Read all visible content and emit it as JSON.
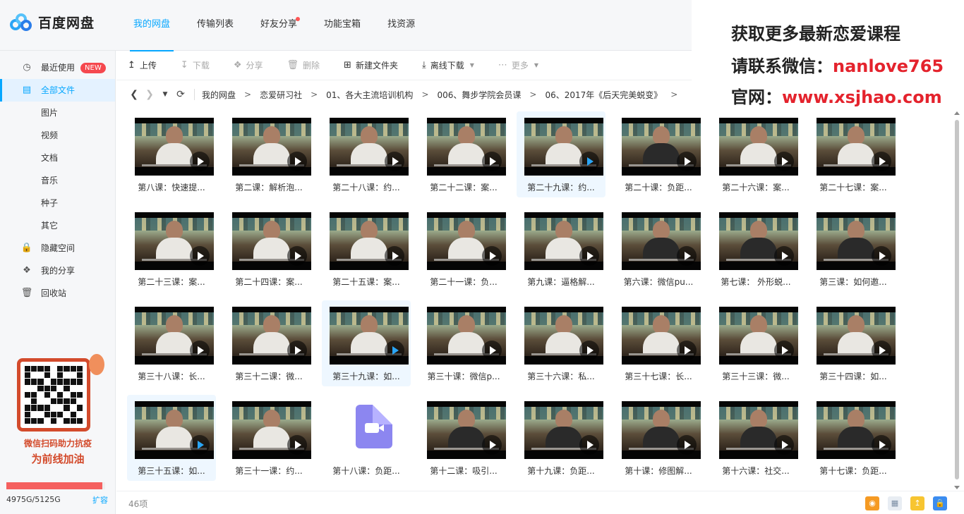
{
  "app": {
    "logo_text": "百度网盘"
  },
  "topnav": [
    {
      "label": "我的网盘",
      "active": true
    },
    {
      "label": "传输列表",
      "active": false
    },
    {
      "label": "好友分享",
      "active": false
    },
    {
      "label": "功能宝箱",
      "active": false
    },
    {
      "label": "找资源",
      "active": false
    }
  ],
  "ad": {
    "line1": "获取更多最新恋爱课程",
    "line2_label": "请联系微信：",
    "line2_value": "nanlove765",
    "line3_label": "官网：",
    "line3_value": "www.xsjhao.com"
  },
  "sidebar": {
    "items": [
      {
        "label": "最近使用",
        "icon": "clock-icon",
        "badge": "NEW"
      },
      {
        "label": "全部文件",
        "icon": "document-icon",
        "active": true
      },
      {
        "label": "图片"
      },
      {
        "label": "视频"
      },
      {
        "label": "文档"
      },
      {
        "label": "音乐"
      },
      {
        "label": "种子"
      },
      {
        "label": "其它"
      },
      {
        "label": "隐藏空间",
        "icon": "lock-icon"
      },
      {
        "label": "我的分享",
        "icon": "share-icon"
      },
      {
        "label": "回收站",
        "icon": "trash-icon"
      }
    ],
    "promo": {
      "line1": "微信扫码助力抗疫",
      "line2": "为前线加油"
    },
    "quota": {
      "text": "4975G/5125G",
      "used_fraction": 0.971,
      "expand_label": "扩容"
    }
  },
  "toolbar": {
    "upload": "上传",
    "download": "下载",
    "share": "分享",
    "delete": "删除",
    "new_folder": "新建文件夹",
    "offline_download": "离线下载",
    "more": "更多"
  },
  "breadcrumb": [
    "我的网盘",
    "恋爱研习社",
    "01、各大主流培训机构",
    "006、舞步学院会员课",
    "06、2017年《后天完美蜕变》"
  ],
  "files": [
    {
      "name": "第八课：快速提...",
      "type": "video",
      "shirt": "light"
    },
    {
      "name": "第二课：解析泡...",
      "type": "video",
      "shirt": "light"
    },
    {
      "name": "第二十八课：约...",
      "type": "video",
      "shirt": "light"
    },
    {
      "name": "第二十二课：案...",
      "type": "video",
      "shirt": "light"
    },
    {
      "name": "第二十九课：约...",
      "type": "video",
      "shirt": "light",
      "selected": true
    },
    {
      "name": "第二十课：负距...",
      "type": "video",
      "shirt": "dark"
    },
    {
      "name": "第二十六课：案...",
      "type": "video",
      "shirt": "light"
    },
    {
      "name": "第二十七课：案...",
      "type": "video",
      "shirt": "light"
    },
    {
      "name": "第二十三课：案...",
      "type": "video",
      "shirt": "light"
    },
    {
      "name": "第二十四课：案...",
      "type": "video",
      "shirt": "light"
    },
    {
      "name": "第二十五课：案...",
      "type": "video",
      "shirt": "light"
    },
    {
      "name": "第二十一课：负...",
      "type": "video",
      "shirt": "light"
    },
    {
      "name": "第九课：逼格解...",
      "type": "video",
      "shirt": "light"
    },
    {
      "name": "第六课：微信pu...",
      "type": "video",
      "shirt": "dark"
    },
    {
      "name": "第七课： 外形蜕...",
      "type": "video",
      "shirt": "dark"
    },
    {
      "name": "第三课：如何邀...",
      "type": "video",
      "shirt": "dark"
    },
    {
      "name": "第三十八课：长...",
      "type": "video",
      "shirt": "light"
    },
    {
      "name": "第三十二课：微...",
      "type": "video",
      "shirt": "light"
    },
    {
      "name": "第三十九课：如...",
      "type": "video",
      "shirt": "light",
      "selected": true
    },
    {
      "name": "第三十课：微信p...",
      "type": "video",
      "shirt": "light"
    },
    {
      "name": "第三十六课：私...",
      "type": "video",
      "shirt": "light"
    },
    {
      "name": "第三十七课：长...",
      "type": "video",
      "shirt": "light"
    },
    {
      "name": "第三十三课：微...",
      "type": "video",
      "shirt": "light"
    },
    {
      "name": "第三十四课：如...",
      "type": "video",
      "shirt": "light"
    },
    {
      "name": "第三十五课：如...",
      "type": "video",
      "shirt": "light",
      "selected": true
    },
    {
      "name": "第三十一课：约...",
      "type": "video",
      "shirt": "light"
    },
    {
      "name": "第十八课：负距...",
      "type": "file"
    },
    {
      "name": "第十二课：吸引...",
      "type": "video",
      "shirt": "dark"
    },
    {
      "name": "第十九课：负距...",
      "type": "video",
      "shirt": "dark"
    },
    {
      "name": "第十课：修图解...",
      "type": "video",
      "shirt": "dark"
    },
    {
      "name": "第十六课：社交...",
      "type": "video",
      "shirt": "dark"
    },
    {
      "name": "第十七课：负距...",
      "type": "video",
      "shirt": "dark"
    }
  ],
  "status": {
    "item_count": "46项"
  },
  "colors": {
    "accent": "#06a7ff",
    "ad_red": "#e4232d",
    "promo_red": "#d34b2c",
    "quota_fill": "#f5605f"
  }
}
